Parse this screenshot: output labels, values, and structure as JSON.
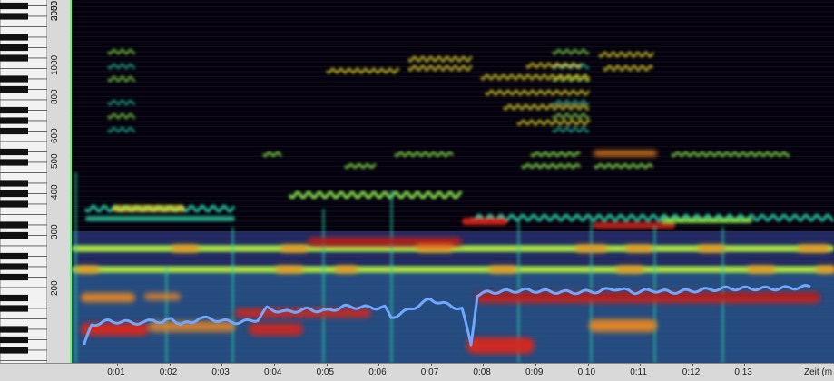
{
  "frequency_axis": {
    "labels": [
      {
        "text": "50",
        "hz": 5000
      },
      {
        "text": "3000",
        "hz": 3000
      },
      {
        "text": "2000",
        "hz": 2000
      },
      {
        "text": "1000",
        "hz": 1000
      },
      {
        "text": "800",
        "hz": 800
      },
      {
        "text": "600",
        "hz": 600
      },
      {
        "text": "500",
        "hz": 500
      },
      {
        "text": "400",
        "hz": 400
      },
      {
        "text": "300",
        "hz": 300
      },
      {
        "text": "200",
        "hz": 200
      }
    ]
  },
  "time_axis": {
    "labels": [
      "0:01",
      "0:02",
      "0:03",
      "0:04",
      "0:05",
      "0:06",
      "0:07",
      "0:08",
      "0:09",
      "0:10",
      "0:11",
      "0:12",
      "0:13"
    ],
    "unit_label": "Zeit (m"
  },
  "colors": {
    "background": "#05020d",
    "palette": [
      "#2a0f5e",
      "#3b4aa8",
      "#2b8bb8",
      "#29c6a0",
      "#8ef04a",
      "#f4e52c",
      "#f08a1e",
      "#d7261b",
      "#8a0b10"
    ],
    "pitch_line": "#6fa8ff",
    "axis_accent": "#5cff5c"
  },
  "icons": {
    "keyboard": "piano-keyboard-icon"
  }
}
